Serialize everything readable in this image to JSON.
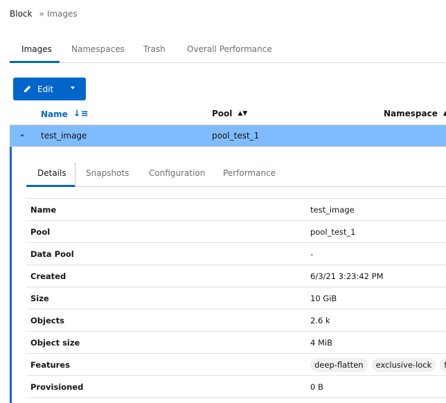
{
  "breadcrumb": {
    "root": "Block",
    "separator": "»",
    "current": "Images"
  },
  "tabs": [
    {
      "label": "Images",
      "active": true
    },
    {
      "label": "Namespaces"
    },
    {
      "label": "Trash"
    },
    {
      "label": "Overall Performance"
    }
  ],
  "toolbar": {
    "edit_label": "Edit"
  },
  "table": {
    "columns": [
      {
        "label": "Name",
        "sorted": "ascending"
      },
      {
        "label": "Pool"
      },
      {
        "label": "Namespace"
      }
    ],
    "rows": [
      {
        "name": "test_image",
        "pool": "pool_test_1",
        "namespace": "",
        "selected": true,
        "expanded": true
      }
    ]
  },
  "detail_tabs": [
    {
      "label": "Details",
      "active": true
    },
    {
      "label": "Snapshots"
    },
    {
      "label": "Configuration"
    },
    {
      "label": "Performance"
    }
  ],
  "details": [
    {
      "label": "Name",
      "value": "test_image"
    },
    {
      "label": "Pool",
      "value": "pool_test_1"
    },
    {
      "label": "Data Pool",
      "value": "-"
    },
    {
      "label": "Created",
      "value": "6/3/21 3:23:42 PM"
    },
    {
      "label": "Size",
      "value": "10 GiB"
    },
    {
      "label": "Objects",
      "value": "2.6 k"
    },
    {
      "label": "Object size",
      "value": "4 MiB"
    },
    {
      "label": "Features",
      "chips": [
        "deep-flatten",
        "exclusive-lock",
        "f"
      ]
    },
    {
      "label": "Provisioned",
      "value": "0 B"
    }
  ],
  "colors": {
    "accent": "#0066cc",
    "selected_row": "#7fbcff"
  }
}
